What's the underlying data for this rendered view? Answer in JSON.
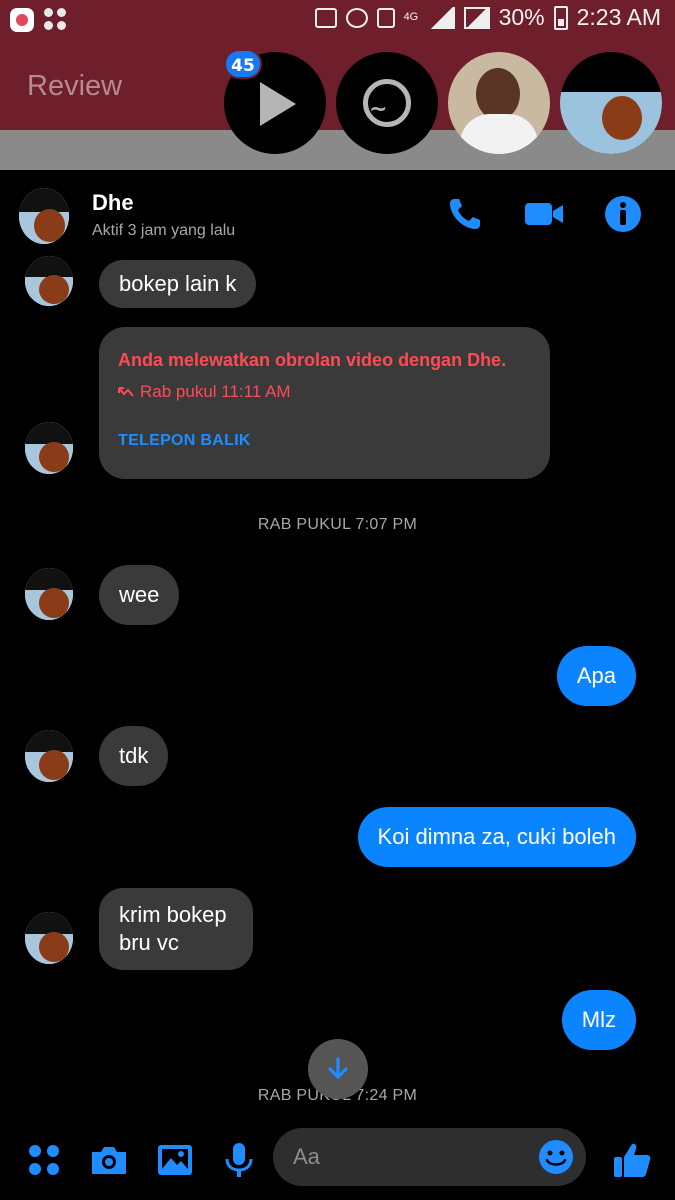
{
  "status_bar": {
    "battery": "30%",
    "time": "2:23 AM",
    "network": "4G"
  },
  "background_app": {
    "title": "Review"
  },
  "chat_heads": {
    "badge_count": "45",
    "items": [
      "play-icon",
      "messenger-icon",
      "contact-photo",
      "contact-photo"
    ]
  },
  "conversation": {
    "contact_name": "Dhe",
    "contact_status": "Aktif 3 jam yang lalu",
    "messages": [
      {
        "from": "them",
        "text": "bokep lain k"
      },
      {
        "from": "them",
        "text": "wee"
      },
      {
        "from": "me",
        "text": "Apa"
      },
      {
        "from": "them",
        "text": "tdk"
      },
      {
        "from": "me",
        "text": "Koi dimna za, cuki boleh"
      },
      {
        "from": "them",
        "text": "krim bokep bru vc"
      },
      {
        "from": "me",
        "text": "Mlz"
      }
    ],
    "missed_call": {
      "title": "Anda melewatkan obrolan video dengan Dhe.",
      "time": "Rab pukul 11:11 AM",
      "action": "TELEPON BALIK"
    },
    "timestamps": [
      "RAB PUKUL 7:07 PM",
      "RAB PUKUL 7:24 PM"
    ]
  },
  "composer": {
    "placeholder": "Aa"
  },
  "colors": {
    "accent": "#0a84ff",
    "missed": "#ff4a56",
    "incoming_bubble": "#3a3a3a",
    "background": "#000000"
  }
}
